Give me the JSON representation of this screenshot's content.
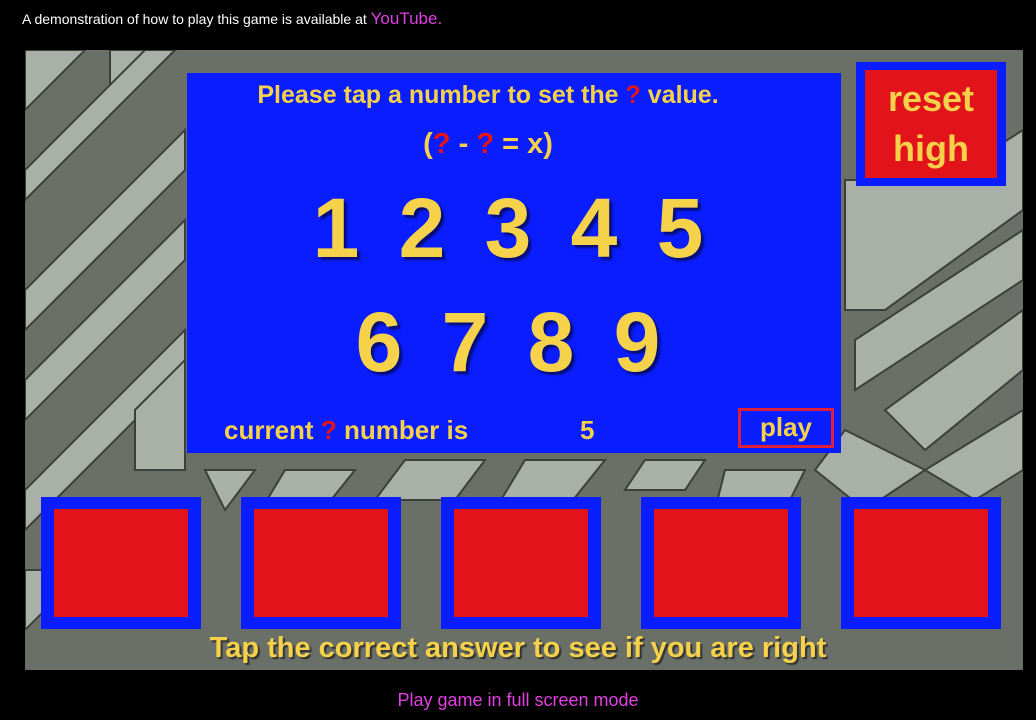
{
  "colors": {
    "panel_blue": "#0a1dff",
    "tile_red": "#e2131a",
    "text_yellow": "#f5d24a",
    "link_magenta": "#e040e0",
    "mark_red": "#e81414"
  },
  "top_notice": {
    "text": "A demonstration of how to play this game is available at",
    "link": "YouTube."
  },
  "panel": {
    "prompt_before": "Please tap a number to set the",
    "prompt_mark": "?",
    "prompt_after": "value.",
    "formula": {
      "open": "(",
      "mark1": "?",
      "minus": "-",
      "mark2": "?",
      "rest": "= x)"
    },
    "numbers_row1": [
      "1",
      "2",
      "3",
      "4",
      "5"
    ],
    "numbers_row2": [
      "6",
      "7",
      "8",
      "9"
    ],
    "status": {
      "before": "current",
      "mark": "?",
      "after": "number is",
      "value": "5"
    },
    "play_label": "play"
  },
  "reset_button": {
    "line1": "reset",
    "line2": "high"
  },
  "answer_tiles": [
    "",
    "",
    "",
    "",
    ""
  ],
  "instruction": "Tap the correct answer to see if you are right",
  "fullscreen_link": "Play game in full screen mode"
}
